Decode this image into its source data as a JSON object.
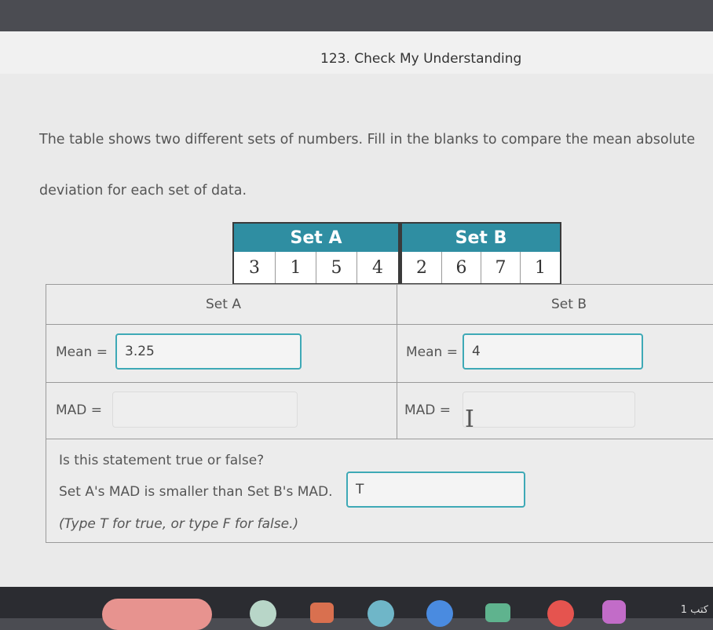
{
  "page": {
    "title": "123. Check My Understanding"
  },
  "prompt": {
    "line1": "The table shows two different sets of numbers. Fill in the blanks to compare the mean absolute",
    "line2": "deviation for each set of data."
  },
  "data_table": {
    "set_a": {
      "header": "Set A",
      "values": [
        "3",
        "1",
        "5",
        "4"
      ]
    },
    "set_b": {
      "header": "Set B",
      "values": [
        "2",
        "6",
        "7",
        "1"
      ]
    },
    "header_color": "#2f8ea2"
  },
  "grid": {
    "col_a_header": "Set A",
    "col_b_header": "Set B",
    "mean_label": "Mean =",
    "mad_label": "MAD =",
    "mean_a_value": "3.25",
    "mean_b_value": "4",
    "mad_a_value": "",
    "mad_b_value": ""
  },
  "question": {
    "prompt": "Is this statement true or false?",
    "statement": "Set A's MAD is smaller than Set B's MAD.",
    "answer": "T",
    "instruction": "(Type T for true, or type F for false.)"
  },
  "accent_color": "#3ea9b6",
  "taskbar": {
    "right_text": "1 ﻛﺘﺐ"
  }
}
